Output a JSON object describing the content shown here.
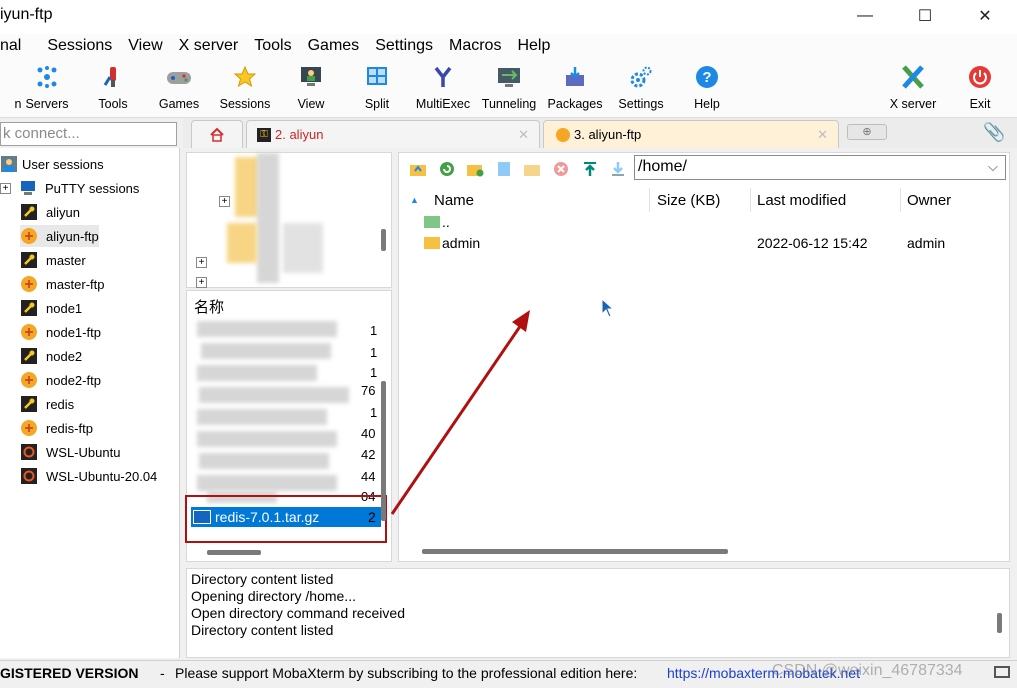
{
  "window": {
    "title": "iyun-ftp",
    "controls": {
      "minimize": "—",
      "maximize": "☐",
      "close": "✕"
    }
  },
  "menu": [
    "nal",
    "Sessions",
    "View",
    "X server",
    "Tools",
    "Games",
    "Settings",
    "Macros",
    "Help"
  ],
  "toolbar": {
    "partial_label": "n",
    "buttons": [
      "Servers",
      "Tools",
      "Games",
      "Sessions",
      "View",
      "Split",
      "MultiExec",
      "Tunneling",
      "Packages",
      "Settings",
      "Help"
    ],
    "right_buttons": [
      "X server",
      "Exit"
    ]
  },
  "quick_connect": {
    "text": "k connect..."
  },
  "tabs": [
    {
      "label": "2. aliyun"
    },
    {
      "label": "3. aliyun-ftp"
    }
  ],
  "sidebar": {
    "groups": [
      "User sessions",
      "PuTTY sessions"
    ],
    "sessions": [
      {
        "label": "aliyun",
        "icon": "key-icon"
      },
      {
        "label": "aliyun-ftp",
        "icon": "ftp-icon"
      },
      {
        "label": "master",
        "icon": "key-icon"
      },
      {
        "label": "master-ftp",
        "icon": "ftp-icon"
      },
      {
        "label": "node1",
        "icon": "key-icon"
      },
      {
        "label": "node1-ftp",
        "icon": "ftp-icon"
      },
      {
        "label": "node2",
        "icon": "key-icon"
      },
      {
        "label": "node2-ftp",
        "icon": "ftp-icon"
      },
      {
        "label": "redis",
        "icon": "key-icon"
      },
      {
        "label": "redis-ftp",
        "icon": "ftp-icon"
      },
      {
        "label": "WSL-Ubuntu",
        "icon": "ubuntu-icon"
      },
      {
        "label": "WSL-Ubuntu-20.04",
        "icon": "ubuntu-icon"
      }
    ]
  },
  "local": {
    "column_name": "名称",
    "selected_file": "redis-7.0.1.tar.gz",
    "selected_size_partial": "2",
    "partial_sizes": [
      "1",
      "1",
      "1",
      "76",
      "1",
      "40",
      "42",
      "44",
      "04"
    ]
  },
  "remote": {
    "path": "/home/",
    "columns": [
      "Name",
      "Size (KB)",
      "Last modified",
      "Owner"
    ],
    "rows": [
      {
        "name": "..",
        "size": "",
        "modified": "",
        "owner": ""
      },
      {
        "name": "admin",
        "size": "",
        "modified": "2022-06-12 15:42",
        "owner": "admin"
      }
    ]
  },
  "log": [
    "Directory content listed",
    "Opening directory /home...",
    "Open directory command received",
    "Directory content listed"
  ],
  "status": {
    "version": "GISTERED VERSION",
    "separator": "-",
    "message": "Please support MobaXterm by subscribing to the professional edition here:",
    "link": "https://mobaxterm.mobatek.net",
    "watermark": "CSDN @weixin_46787334"
  },
  "colors": {
    "accent_blue": "#1a73e8",
    "selection": "#0078d7",
    "annotation_red": "#b01010",
    "tab_active": "#fff1d8",
    "folder": "#f6c142"
  }
}
